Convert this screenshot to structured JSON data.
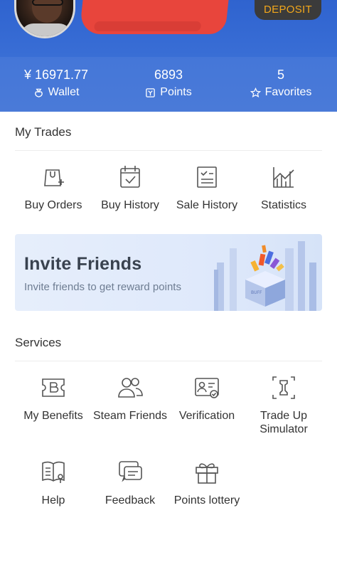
{
  "header": {
    "deposit_label": "DEPOSIT",
    "stats": [
      {
        "value": "¥ 16971.77",
        "label": "Wallet",
        "icon": "wallet-icon"
      },
      {
        "value": "6893",
        "label": "Points",
        "icon": "points-icon"
      },
      {
        "value": "5",
        "label": "Favorites",
        "icon": "star-icon"
      }
    ]
  },
  "my_trades": {
    "title": "My Trades",
    "items": [
      {
        "label": "Buy Orders",
        "icon": "bag-add-icon"
      },
      {
        "label": "Buy History",
        "icon": "calendar-check-icon"
      },
      {
        "label": "Sale History",
        "icon": "document-list-icon"
      },
      {
        "label": "Statistics",
        "icon": "chart-icon"
      }
    ]
  },
  "banner": {
    "title": "Invite Friends",
    "subtitle": "Invite friends to get reward points",
    "art_text": "BUFF"
  },
  "services": {
    "title": "Services",
    "items": [
      {
        "label": "My Benefits",
        "icon": "ticket-icon"
      },
      {
        "label": "Steam Friends",
        "icon": "friends-icon"
      },
      {
        "label": "Verification",
        "icon": "id-card-icon"
      },
      {
        "label": "Trade Up\nSimulator",
        "icon": "trade-up-icon"
      },
      {
        "label": "Help",
        "icon": "help-book-icon"
      },
      {
        "label": "Feedback",
        "icon": "feedback-icon"
      },
      {
        "label": "Points lottery",
        "icon": "gift-icon"
      }
    ]
  },
  "colors": {
    "header_blue": "#3a6fd6",
    "deposit_text": "#f2a71b",
    "icon_stroke": "#555555"
  }
}
